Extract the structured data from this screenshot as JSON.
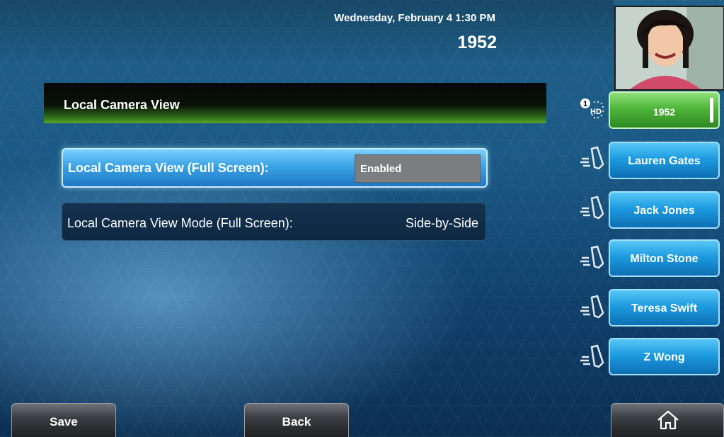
{
  "header": {
    "datetime": "Wednesday, February 4  1:30 PM",
    "extension": "1952"
  },
  "panel": {
    "title": "Local Camera View",
    "settings": [
      {
        "label": "Local Camera View (Full Screen):",
        "value": "Enabled"
      },
      {
        "label": "Local Camera View Mode (Full Screen):",
        "value": "Side-by-Side"
      }
    ]
  },
  "line_keys": [
    {
      "label": "1952",
      "state": "active",
      "icon": "hd-status-icon",
      "badge": "1",
      "icon_text": "HD"
    },
    {
      "label": "Lauren Gates",
      "icon": "handset-icon"
    },
    {
      "label": "Jack Jones",
      "icon": "handset-icon"
    },
    {
      "label": "Milton Stone",
      "icon": "handset-icon"
    },
    {
      "label": "Teresa Swift",
      "icon": "handset-icon"
    },
    {
      "label": "Z Wong",
      "icon": "handset-icon"
    }
  ],
  "softkeys": {
    "save": "Save",
    "back": "Back",
    "home_icon": "home-icon"
  },
  "colors": {
    "active_key": "#4fb53b",
    "contact_key": "#1d9be0",
    "selected_row": "#3ba3e6"
  }
}
